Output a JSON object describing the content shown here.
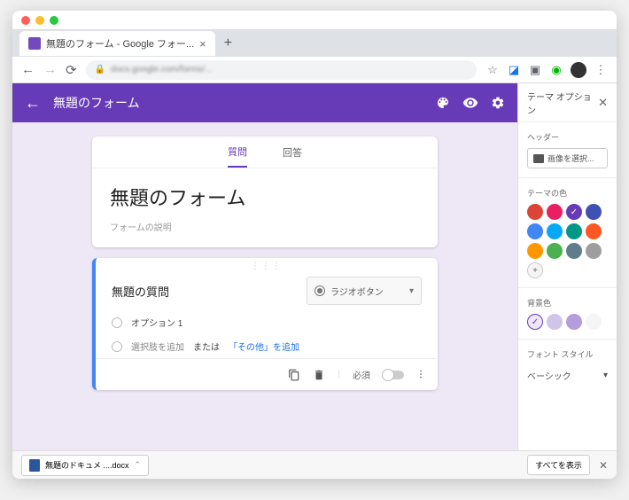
{
  "browser": {
    "tab_title": "無題のフォーム - Google フォー...",
    "url": "docs.google.com/forms/...",
    "download_item": "無題のドキュメ ....docx",
    "show_all": "すべてを表示"
  },
  "header": {
    "title": "無題のフォーム"
  },
  "form": {
    "tabs": {
      "questions": "質問",
      "responses": "回答"
    },
    "title": "無題のフォーム",
    "description": "フォームの説明",
    "question": {
      "title": "無題の質問",
      "type_label": "ラジオボタン",
      "option1": "オプション 1",
      "add_option": "選択肢を追加",
      "or": " または ",
      "add_other": "「その他」を追加",
      "required": "必須"
    }
  },
  "theme": {
    "panel_title": "テーマ オプション",
    "header_label": "ヘッダー",
    "choose_image": "画像を選択...",
    "theme_color_label": "テーマの色",
    "theme_colors": [
      "#db4437",
      "#e91e63",
      "#673ab7",
      "#3f51b5",
      "#4285f4",
      "#03a9f4",
      "#009688",
      "#ff5722",
      "#ff9800",
      "#4caf50",
      "#607d8b",
      "#9e9e9e"
    ],
    "selected_theme": 2,
    "bg_label": "背景色",
    "bg_colors": [
      "#ede7f6",
      "#d1c4e9",
      "#b39ddb",
      "#f5f5f5"
    ],
    "selected_bg": 0,
    "font_label": "フォント スタイル",
    "font_value": "ベーシック"
  }
}
